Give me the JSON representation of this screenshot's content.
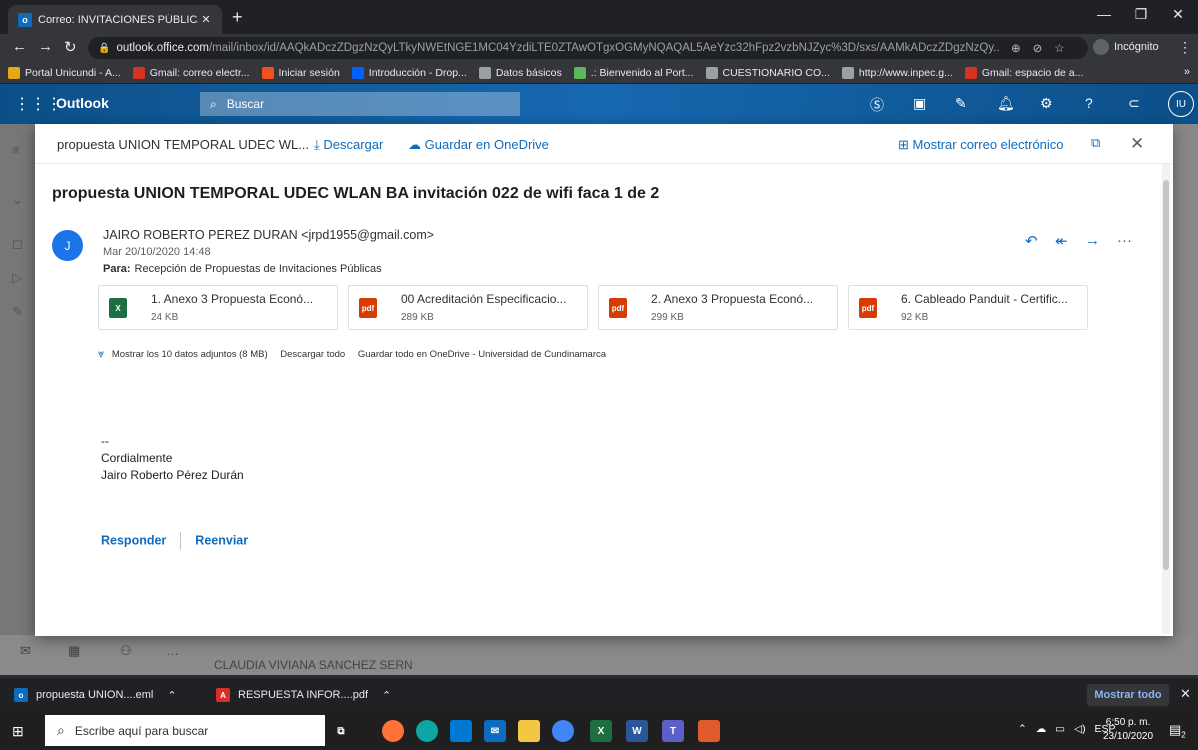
{
  "browser": {
    "tab_title": "Correo: INVITACIONES PÚBLICAS",
    "tab_icon": "o",
    "url_host": "outlook.office.com",
    "url_path": "/mail/inbox/id/AAQkADczZDgzNzQyLTkyNWEtNGE1MC04YzdiLTE0ZTAwOTgxOGMyNQAQAL5AeYzc32hFpz2vzbNJZyc%3D/sxs/AAMkADczZDgzNzQy...",
    "incognito_label": "Incógnito",
    "bookmarks": [
      {
        "label": "Portal Unicundi - A...",
        "color": "#e6a817"
      },
      {
        "label": "Gmail: correo electr...",
        "color": "#d93025"
      },
      {
        "label": "Iniciar sesión",
        "color": "#f25022"
      },
      {
        "label": "Introducción - Drop...",
        "color": "#0061fe"
      },
      {
        "label": "Datos básicos",
        "color": "#9aa0a6"
      },
      {
        "label": ".: Bienvenido al Port...",
        "color": "#5cb85c"
      },
      {
        "label": "CUESTIONARIO CO...",
        "color": "#9aa0a6"
      },
      {
        "label": "http://www.inpec.g...",
        "color": "#9aa0a6"
      },
      {
        "label": "Gmail: espacio de a...",
        "color": "#d93025"
      }
    ],
    "bookmarks_more": "»"
  },
  "owa": {
    "brand": "Outlook",
    "search_placeholder": "Buscar",
    "user_initials": "IU",
    "bg_sender": "CLAUDIA VIVIANA SANCHEZ SERN"
  },
  "modal": {
    "file_name": "propuesta UNION TEMPORAL UDEC WL...",
    "download_label": "Descargar",
    "save_onedrive_label": "Guardar en OneDrive",
    "show_email_label": "Mostrar correo electrónico",
    "subject": "propuesta UNION TEMPORAL UDEC WLAN BA invitación 022 de wifi faca 1 de 2",
    "sender_initial": "J",
    "sender": "JAIRO ROBERTO PEREZ DURAN <jrpd1955@gmail.com>",
    "date": "Mar 20/10/2020 14:48",
    "to_label": "Para:",
    "to_value": "Recepción de Propuestas de Invitaciones Públicas",
    "attachments": [
      {
        "name": "1. Anexo 3 Propuesta Econó...",
        "size": "24 KB",
        "type": "xlsx",
        "icon_color": "#1d6f42",
        "icon_text": "X"
      },
      {
        "name": "00 Acreditación Especificacio...",
        "size": "289 KB",
        "type": "pdf",
        "icon_color": "#d83b01",
        "icon_text": "pdf"
      },
      {
        "name": "2. Anexo 3 Propuesta Econó...",
        "size": "299 KB",
        "type": "pdf",
        "icon_color": "#d83b01",
        "icon_text": "pdf"
      },
      {
        "name": "6. Cableado Panduit - Certific...",
        "size": "92 KB",
        "type": "pdf",
        "icon_color": "#d83b01",
        "icon_text": "pdf"
      }
    ],
    "show_all_attachments": "Mostrar los 10 datos adjuntos (8 MB)",
    "download_all": "Descargar todo",
    "save_all_onedrive": "Guardar todo en OneDrive - Universidad de Cundinamarca",
    "signature_dashes": "--",
    "signature_line1": "Cordialmente",
    "signature_line2": "Jairo Roberto Pérez Durán",
    "reply_label": "Responder",
    "forward_label": "Reenviar"
  },
  "downloads": {
    "item1": "propuesta UNION....eml",
    "item2": "RESPUESTA INFOR....pdf",
    "show_all": "Mostrar todo"
  },
  "taskbar": {
    "search_placeholder": "Escribe aquí para buscar",
    "lang": "ESP",
    "time": "6:50 p. m.",
    "date": "23/10/2020",
    "notif_count": "2"
  }
}
